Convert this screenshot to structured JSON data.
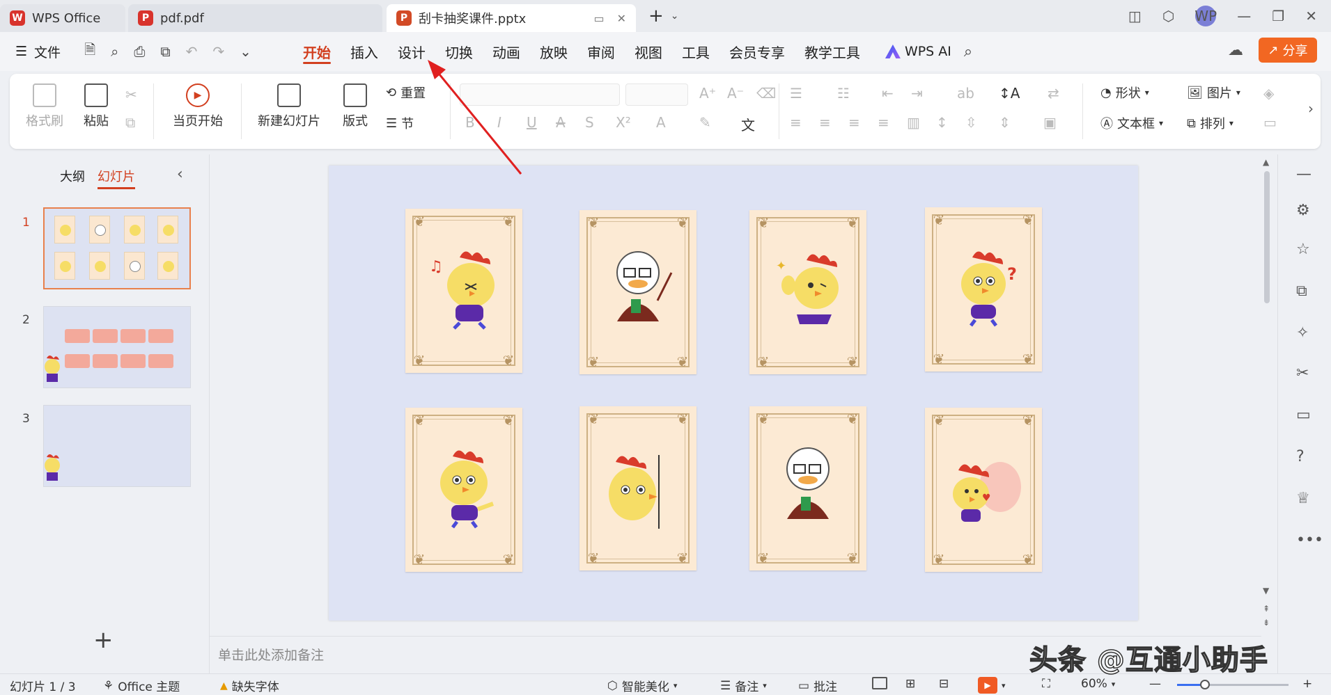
{
  "titlebar": {
    "tabs": [
      {
        "label": "WPS Office",
        "color": "#d8332c"
      },
      {
        "label": "pdf.pdf",
        "color": "#d8332c"
      },
      {
        "label": "刮卡抽奖课件.pptx",
        "color": "#d24a26"
      }
    ],
    "avatar": "WP"
  },
  "menu": {
    "file": "文件",
    "tabs": [
      "开始",
      "插入",
      "设计",
      "切换",
      "动画",
      "放映",
      "审阅",
      "视图",
      "工具",
      "会员专享",
      "教学工具"
    ],
    "active_tab": "开始",
    "wps_ai": "WPS AI",
    "share": "分享"
  },
  "ribbon": {
    "format_painter": "格式刷",
    "paste": "粘贴",
    "from_current": "当页开始",
    "new_slide": "新建幻灯片",
    "layout": "版式",
    "reset": "重置",
    "section": "节",
    "shape": "形状",
    "picture": "图片",
    "textbox": "文本框",
    "arrange": "排列"
  },
  "left_panel": {
    "tabs": [
      "大纲",
      "幻灯片"
    ],
    "active_tab": "幻灯片",
    "slides": [
      "1",
      "2",
      "3"
    ],
    "active_slide": "1"
  },
  "notes_placeholder": "单击此处添加备注",
  "status": {
    "slide_info": "幻灯片 1 / 3",
    "theme": "Office 主题",
    "missing_font": "缺失字体",
    "beautify": "智能美化",
    "notes": "备注",
    "comments": "批注",
    "zoom": "60%",
    "zoom_level": 0.25
  },
  "watermark": "头条 @互通小助手",
  "colors": {
    "accent": "#d23f1f",
    "share": "#f26722",
    "slide_bg": "#dee3f4",
    "card_bg": "#fcead4"
  }
}
